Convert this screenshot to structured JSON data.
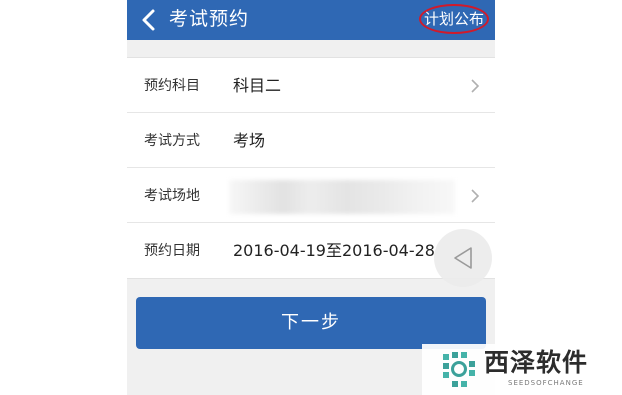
{
  "navbar": {
    "title": "考试预约",
    "action_label": "计划公布",
    "back_icon": "chevron-left-icon",
    "bg_color": "#2f68b4",
    "highlight_color": "#d11a2a"
  },
  "form": {
    "rows": [
      {
        "label": "预约科目",
        "value": "科目二",
        "has_chevron": true
      },
      {
        "label": "考试方式",
        "value": "考场",
        "has_chevron": false
      },
      {
        "label": "考试场地",
        "value": "",
        "has_chevron": true
      },
      {
        "label": "预约日期",
        "value": "2016-04-19至2016-04-28",
        "has_chevron": false
      }
    ]
  },
  "floating_button": {
    "icon": "triangle-back-icon"
  },
  "next_button": {
    "label": "下一步"
  },
  "watermark": {
    "name": "西泽软件",
    "tagline": "SEEDSOFCHANGE"
  }
}
